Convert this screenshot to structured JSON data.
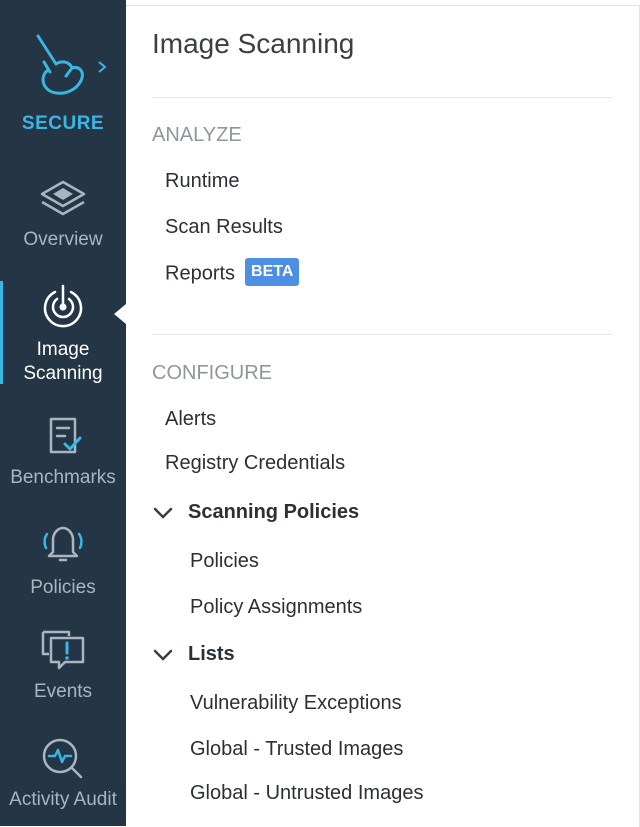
{
  "sidebar": {
    "brand": "SECURE",
    "items": [
      {
        "label": "Overview",
        "icon": "layers-icon"
      },
      {
        "label_lines": [
          "Image",
          "Scanning"
        ],
        "icon": "scan-target-icon",
        "active": true
      },
      {
        "label": "Benchmarks",
        "icon": "clipboard-check-icon"
      },
      {
        "label": "Policies",
        "icon": "bell-icon"
      },
      {
        "label": "Events",
        "icon": "chat-alert-icon"
      },
      {
        "label": "Activity Audit",
        "icon": "magnifier-pulse-icon"
      }
    ]
  },
  "panel": {
    "title": "Image Scanning",
    "analyze": {
      "heading": "ANALYZE",
      "items": [
        "Runtime",
        "Scan Results",
        "Reports"
      ],
      "reports_badge": "BETA"
    },
    "configure": {
      "heading": "CONFIGURE",
      "items": [
        "Alerts",
        "Registry Credentials"
      ],
      "groups": [
        {
          "label": "Scanning Policies",
          "items": [
            "Policies",
            "Policy Assignments"
          ]
        },
        {
          "label": "Lists",
          "items": [
            "Vulnerability Exceptions",
            "Global - Trusted Images",
            "Global - Untrusted Images"
          ]
        }
      ]
    }
  },
  "colors": {
    "sidebar_bg": "#243545",
    "accent": "#39b6e4",
    "badge": "#4d8fe3"
  }
}
